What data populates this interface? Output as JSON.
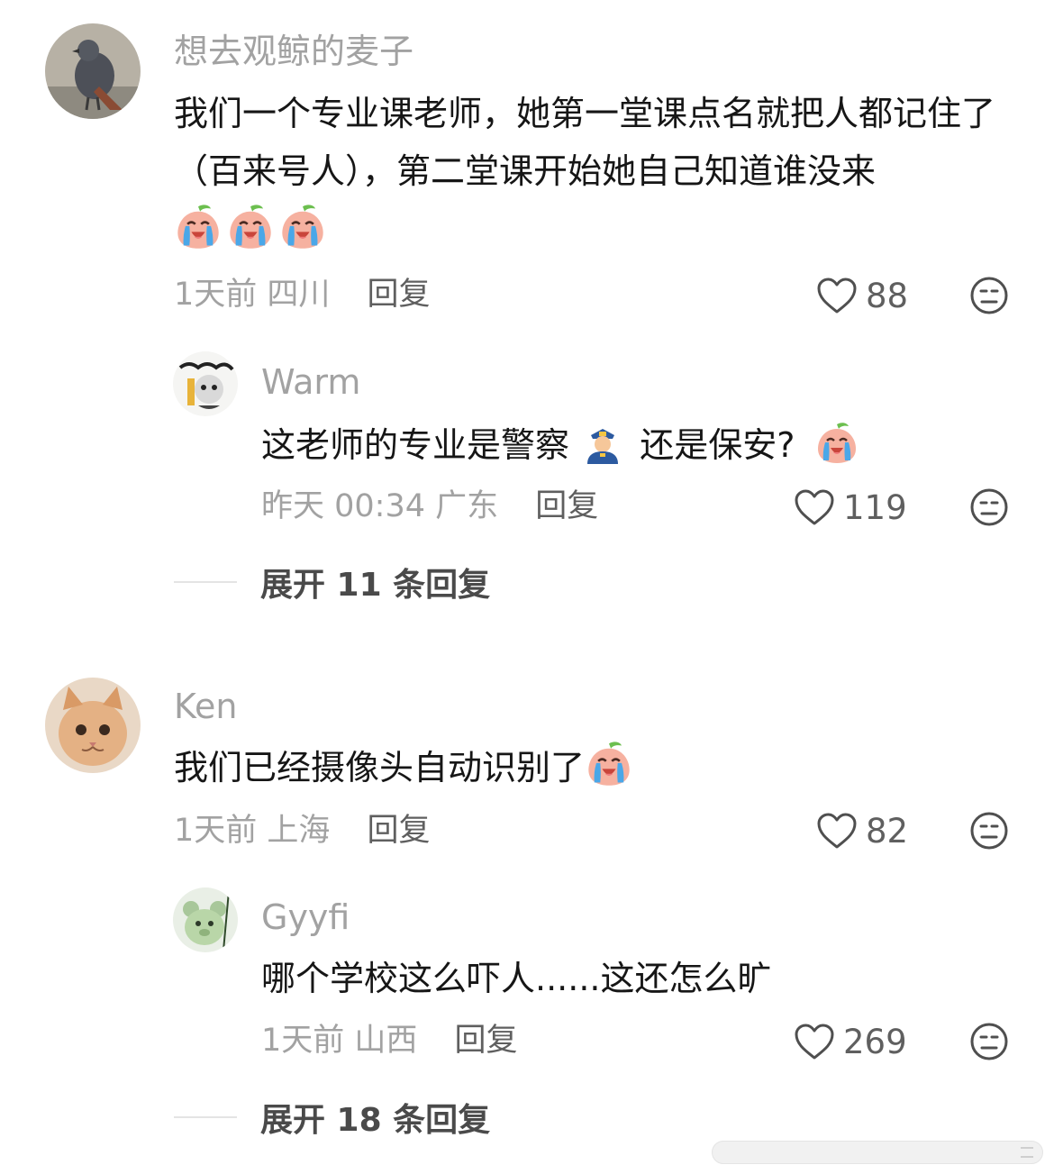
{
  "comments": [
    {
      "username": "想去观鲸的麦子",
      "text": "我们一个专业课老师，她第一堂课点名就把人都记住了（百来号人），第二堂课开始她自己知道谁没来",
      "emojis": [
        "crying-peach-emoji",
        "crying-peach-emoji",
        "crying-peach-emoji"
      ],
      "time_location": "1天前 四川",
      "reply_label": "回复",
      "likes": "88",
      "replies": [
        {
          "username": "Warm",
          "text_before": "这老师的专业是警察",
          "text_after": "还是保安?",
          "emojis": [
            "police-officer-emoji",
            "crying-peach-emoji"
          ],
          "time_location": "昨天 00:34 广东",
          "reply_label": "回复",
          "likes": "119"
        }
      ],
      "expand_label": "展开 11 条回复"
    },
    {
      "username": "Ken",
      "text": "我们已经摄像头自动识别了",
      "emojis": [
        "crying-peach-emoji"
      ],
      "time_location": "1天前 上海",
      "reply_label": "回复",
      "likes": "82",
      "replies": [
        {
          "username": "Gyyfi",
          "text": "哪个学校这么吓人......这还怎么旷",
          "time_location": "1天前 山西",
          "reply_label": "回复",
          "likes": "269"
        }
      ],
      "expand_label": "展开 18 条回复"
    }
  ],
  "icons": {
    "like": "heart-outline-icon",
    "dislike": "neutral-face-icon"
  },
  "colors": {
    "meta_gray": "#a2a2a2",
    "text": "#161616",
    "emoji_peach": "#f29a88"
  }
}
